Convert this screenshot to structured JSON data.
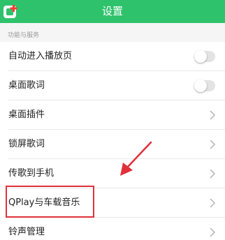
{
  "header": {
    "title": "设置",
    "back_icon": "back-plus-icon",
    "accent_color": "#2fc26c"
  },
  "section": {
    "label": "功能与服务"
  },
  "rows": [
    {
      "label": "自动进入播放页",
      "control": "toggle",
      "toggle_on": false
    },
    {
      "label": "桌面歌词",
      "control": "toggle",
      "toggle_on": false
    },
    {
      "label": "桌面插件",
      "control": "chevron"
    },
    {
      "label": "锁屏歌词",
      "control": "chevron"
    },
    {
      "label": "传歌到手机",
      "control": "chevron"
    },
    {
      "label": "QPlay与车载音乐",
      "control": "chevron"
    },
    {
      "label": "铃声管理",
      "control": "chevron"
    }
  ],
  "annotation": {
    "color": "#e0303a",
    "target_row": "QPlay与车载音乐"
  }
}
